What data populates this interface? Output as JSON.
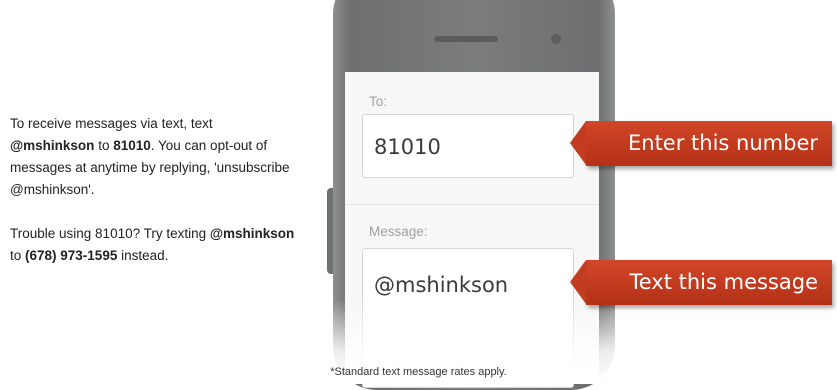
{
  "instructions": {
    "p1_a": "To receive messages via text, text ",
    "p1_handle": "@mshinkson",
    "p1_b": " to ",
    "p1_number": "81010",
    "p1_c": ". You can opt-out of messages at anytime by replying, 'unsubscribe @mshinkson'.",
    "p2_a": "Trouble using 81010? Try texting ",
    "p2_handle": "@mshinkson",
    "p2_b": " to ",
    "p2_phone": "(678) 973-1595",
    "p2_c": " instead."
  },
  "phone": {
    "to_label": "To:",
    "to_value": "81010",
    "message_label": "Message:",
    "message_value": "@mshinkson"
  },
  "callouts": {
    "number": "Enter this number",
    "message": "Text this message"
  },
  "footnote": "*Standard text message rates apply.",
  "colors": {
    "callout": "#c23c21",
    "phone_body": "#7b7c7c",
    "screen": "#f7f7f7"
  }
}
